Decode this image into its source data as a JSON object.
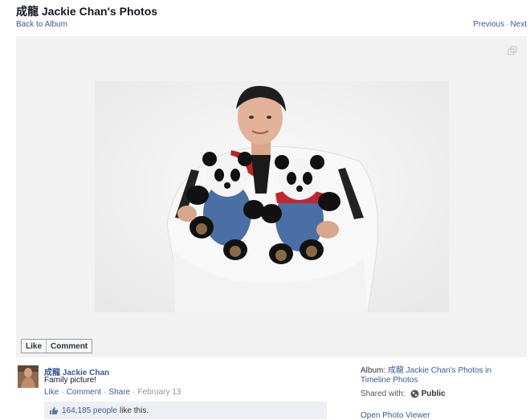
{
  "header": {
    "title": "成龍 Jackie Chan's Photos",
    "back_link": "Back to Album",
    "previous": "Previous",
    "separator": "·",
    "next": "Next"
  },
  "photo_actions": {
    "like": "Like",
    "comment": "Comment"
  },
  "post": {
    "author": "成龍 Jackie Chan",
    "caption": "Family picture!",
    "actions": {
      "like": "Like",
      "comment": "Comment",
      "share": "Share",
      "date": "February 13",
      "sep": "·"
    },
    "likes": {
      "count": "164,185 people",
      "suffix": "like this."
    }
  },
  "sidebar": {
    "album_prefix": "Album:",
    "album_name": "成龍 Jackie Chan's Photos in Timeline Photos",
    "shared_label": "Shared with:",
    "audience": "Public",
    "open_viewer": "Open Photo Viewer"
  },
  "colors": {
    "link": "#3b5998",
    "stage_bg": "#f2f2f2",
    "likes_bg": "#edeff4"
  },
  "icons": [
    "expand-icon",
    "thumbs-up-icon",
    "globe-icon"
  ]
}
